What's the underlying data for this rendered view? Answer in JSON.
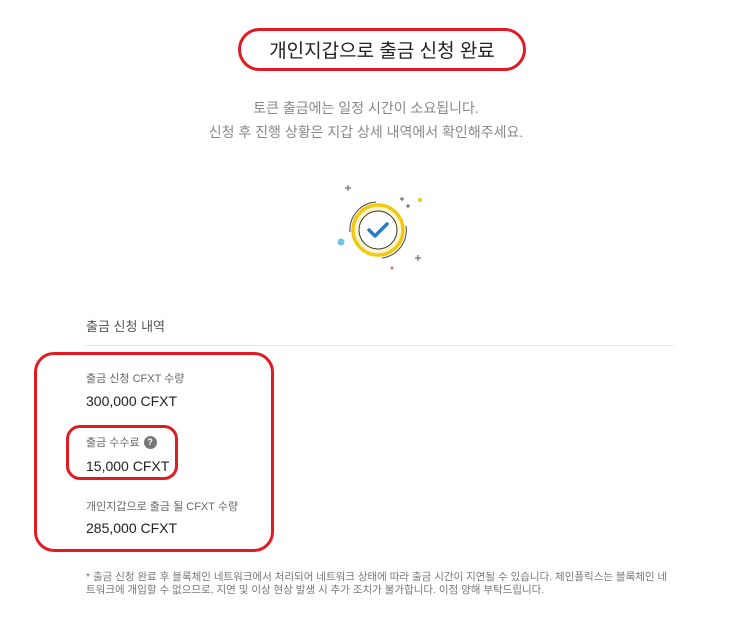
{
  "header": {
    "title": "개인지갑으로 출금 신청 완료",
    "subtitle_line1": "토큰 출금에는 일정 시간이 소요됩니다.",
    "subtitle_line2": "신청 후 진행 상황은 지갑 상세 내역에서 확인해주세요."
  },
  "illustration": {
    "icon": "check-circle-icon",
    "accent_color": "#f2c811",
    "check_color": "#2b7bc4"
  },
  "details": {
    "section_title": "출금 신청 내역",
    "requested_label": "출금 신청 CFXT 수량",
    "requested_value": "300,000 CFXT",
    "fee_label": "출금 수수료",
    "fee_help_icon": "question-icon",
    "fee_value": "15,000 CFXT",
    "net_label": "개인지갑으로 출금 될 CFXT 수량",
    "net_value": "285,000 CFXT"
  },
  "notice": "* 출금 신청 완료 후 블록체인 네트워크에서 처리되어 네트워크 상태에 따라 출금 시간이 지연될 수 있습니다. 체인플릭스는 블록체인 네트워크에 개입할 수 없으므로, 지연 및 이상 현상 발생 시 추가 조치가 불가합니다. 이점 양해 부탁드립니다.",
  "colors": {
    "highlight": "#e01b24",
    "muted_text": "#888888"
  }
}
